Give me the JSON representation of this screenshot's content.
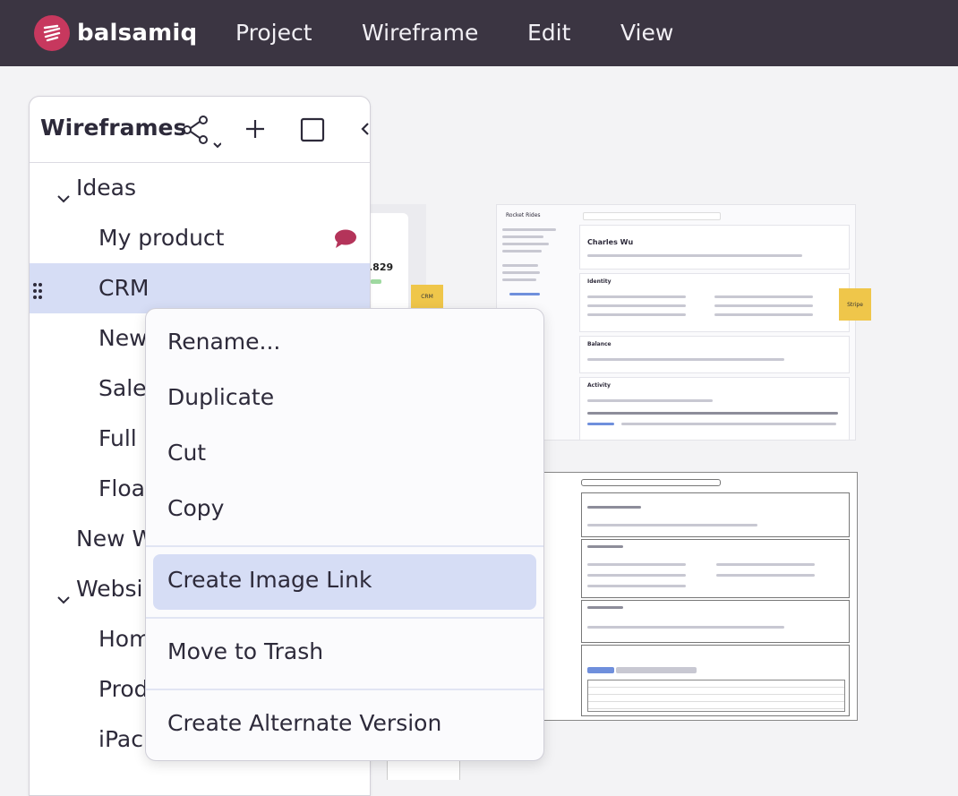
{
  "app": {
    "brand": "balsamiq",
    "brand_color": "#c7385e"
  },
  "menubar": {
    "items": [
      "Project",
      "Wireframe",
      "Edit",
      "View"
    ]
  },
  "panel": {
    "title": "Wireframes",
    "tree": [
      {
        "label": "Ideas",
        "type": "folder",
        "expanded": true
      },
      {
        "label": "My product",
        "type": "item",
        "has_comment": true
      },
      {
        "label": "CRM",
        "type": "item",
        "selected": true
      },
      {
        "label": "New",
        "type": "item"
      },
      {
        "label": "Sale",
        "type": "item"
      },
      {
        "label": "Full",
        "type": "item"
      },
      {
        "label": "Floa",
        "type": "item"
      },
      {
        "label": "New W",
        "type": "item"
      },
      {
        "label": "Websi",
        "type": "folder",
        "expanded": true
      },
      {
        "label": "Hom",
        "type": "item"
      },
      {
        "label": "Prod",
        "type": "item"
      },
      {
        "label": "iPac",
        "type": "item"
      }
    ]
  },
  "context_menu": {
    "items": [
      "Rename...",
      "Duplicate",
      "Cut",
      "Copy",
      "Create Image Link",
      "Move to Trash",
      "Create Alternate Version"
    ],
    "highlighted": "Create Image Link"
  },
  "canvas": {
    "sticky_crm": "CRM",
    "sticky_stripe": "Stripe",
    "thumb_a_value": ".829",
    "thumb_b_title": "Charles Wu",
    "thumb_b_app": "Rocket Rides",
    "thumb_b_sections": [
      "Identity",
      "Balance",
      "Activity"
    ]
  },
  "colors": {
    "topbar": "#3b3542",
    "selection": "#d6ddf5",
    "sticky": "#efc64a",
    "comment": "#b4345a"
  }
}
